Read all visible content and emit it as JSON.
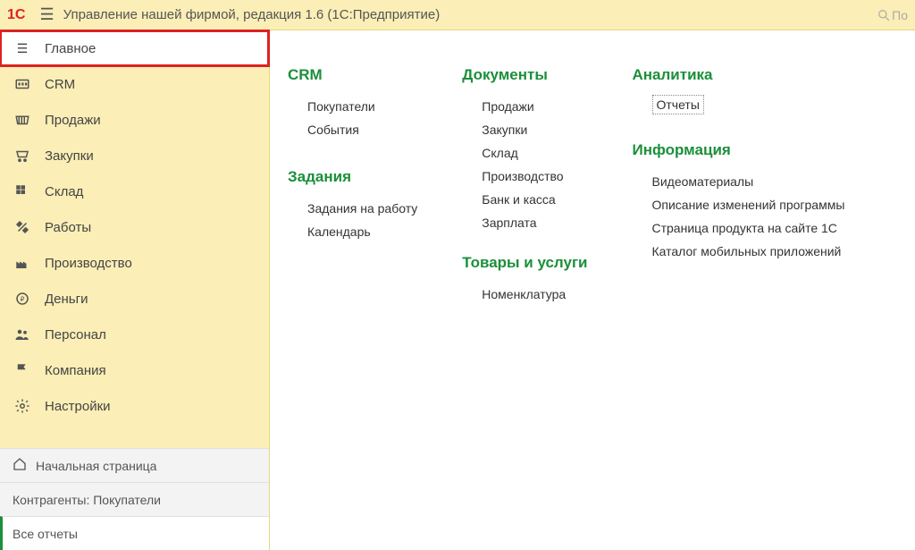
{
  "header": {
    "logo": "1C",
    "title": "Управление нашей фирмой, редакция 1.6  (1С:Предприятие)",
    "search_placeholder": "По"
  },
  "sidebar": {
    "items": [
      {
        "label": "Главное"
      },
      {
        "label": "CRM"
      },
      {
        "label": "Продажи"
      },
      {
        "label": "Закупки"
      },
      {
        "label": "Склад"
      },
      {
        "label": "Работы"
      },
      {
        "label": "Производство"
      },
      {
        "label": "Деньги"
      },
      {
        "label": "Персонал"
      },
      {
        "label": "Компания"
      },
      {
        "label": "Настройки"
      }
    ],
    "bottom": [
      {
        "label": "Начальная страница"
      },
      {
        "label": "Контрагенты: Покупатели"
      },
      {
        "label": "Все отчеты"
      }
    ]
  },
  "main": {
    "col1": {
      "g1_title": "CRM",
      "g1_items": [
        "Покупатели",
        "События"
      ],
      "g2_title": "Задания",
      "g2_items": [
        "Задания на работу",
        "Календарь"
      ]
    },
    "col2": {
      "g1_title": "Документы",
      "g1_items": [
        "Продажи",
        "Закупки",
        "Склад",
        "Производство",
        "Банк и касса",
        "Зарплата"
      ],
      "g2_title": "Товары и услуги",
      "g2_items": [
        "Номенклатура"
      ]
    },
    "col3": {
      "g1_title": "Аналитика",
      "g1_items": [
        "Отчеты"
      ],
      "g2_title": "Информация",
      "g2_items": [
        "Видеоматериалы",
        "Описание изменений программы",
        "Страница продукта на сайте 1С",
        "Каталог мобильных приложений"
      ]
    }
  }
}
